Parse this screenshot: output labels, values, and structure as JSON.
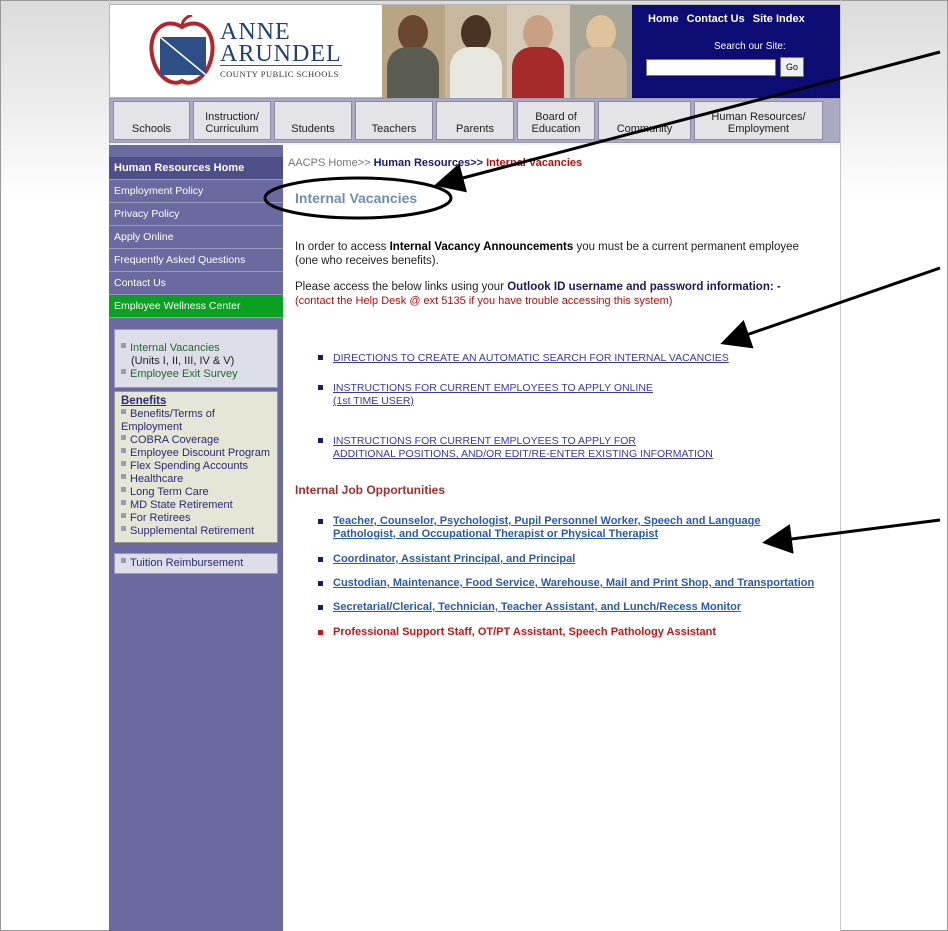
{
  "header": {
    "logo_line1": "ANNE",
    "logo_line2": "ARUNDEL",
    "logo_line3": "COUNTY PUBLIC SCHOOLS",
    "top_links": [
      "Home",
      "Contact Us",
      "Site Index"
    ],
    "search_label": "Search our Site:",
    "search_value": "",
    "go_label": "Go"
  },
  "nav": {
    "tabs": [
      {
        "l1": "",
        "l2": "Schools"
      },
      {
        "l1": "Instruction/",
        "l2": "Curriculum"
      },
      {
        "l1": "",
        "l2": "Students"
      },
      {
        "l1": "",
        "l2": "Teachers"
      },
      {
        "l1": "",
        "l2": "Parents"
      },
      {
        "l1": "Board of",
        "l2": "Education"
      },
      {
        "l1": "",
        "l2": "Community"
      },
      {
        "l1": "Human Resources/",
        "l2": "Employment"
      }
    ]
  },
  "sidebar": {
    "items": [
      "Human Resources Home",
      "Employment Policy",
      "Privacy Policy",
      "Apply Online",
      "Frequently Asked Questions",
      "Contact Us",
      "Employee Wellness Center"
    ],
    "box1": {
      "internal_vacancies": "Internal Vacancies",
      "units": "(Units I, II, III, IV & V)",
      "exit_survey": "Employee Exit Survey"
    },
    "benefits": {
      "title": "Benefits",
      "items": [
        "Benefits/Terms of Employment",
        "COBRA Coverage",
        "Employee Discount Program",
        "Flex Spending Accounts",
        "Healthcare",
        "Long Term Care",
        "MD State Retirement",
        "For Retirees",
        "Supplemental Retirement"
      ]
    },
    "tuition": "Tuition Reimbursement"
  },
  "content": {
    "breadcrumb": {
      "home": "AACPS Home>>",
      "hr": "Human Resources>>",
      "current": "Internal Vacancies"
    },
    "title": "Internal Vacancies",
    "intro_a": "In order to access ",
    "intro_b": "Internal Vacancy Announcements",
    "intro_c": " you must be a current permanent employee",
    "intro_d": "(one who receives benefits).",
    "access_a": "Please access the below links using your ",
    "access_b": "Outlook ID username and password information: -",
    "help": "(contact the Help Desk @ ext 5135 if you have trouble accessing this system)",
    "links": [
      {
        "l1": "DIRECTIONS TO CREATE AN AUTOMATIC SEARCH FOR INTERNAL VACANCIES",
        "l2": ""
      },
      {
        "l1": "INSTRUCTIONS FOR CURRENT EMPLOYEES TO APPLY ONLINE",
        "l2": "(1st TIME USER)"
      },
      {
        "l1": "INSTRUCTIONS FOR CURRENT EMPLOYEES TO APPLY FOR",
        "l2": "ADDITIONAL POSITIONS, AND/OR EDIT/RE-ENTER EXISTING INFORMATION"
      }
    ],
    "section_heading": "Internal Job Opportunities",
    "jobs": [
      {
        "l1": "Teacher, Counselor, Psychologist, Pupil Personnel Worker, Speech and Language",
        "l2": "Pathologist, and Occupational Therapist or Physical Therapist"
      },
      {
        "l1": "Coordinator, Assistant Principal, and Principal",
        "l2": ""
      },
      {
        "l1": "Custodian, Maintenance, Food Service, Warehouse, Mail and Print Shop, and Transportation",
        "l2": ""
      },
      {
        "l1": "Secretarial/Clerical, Technician, Teacher Assistant, and Lunch/Recess Monitor",
        "l2": ""
      },
      {
        "l1": "Professional Support Staff, OT/PT Assistant, Speech Pathology Assistant",
        "l2": ""
      }
    ]
  },
  "colors": {
    "top_box": "#0c0c72",
    "sidebar": "#6a6aa0",
    "wellness": "#0aa020",
    "title": "#6d8eb0",
    "link": "#3a3aa0",
    "alert_red": "#b01010"
  }
}
